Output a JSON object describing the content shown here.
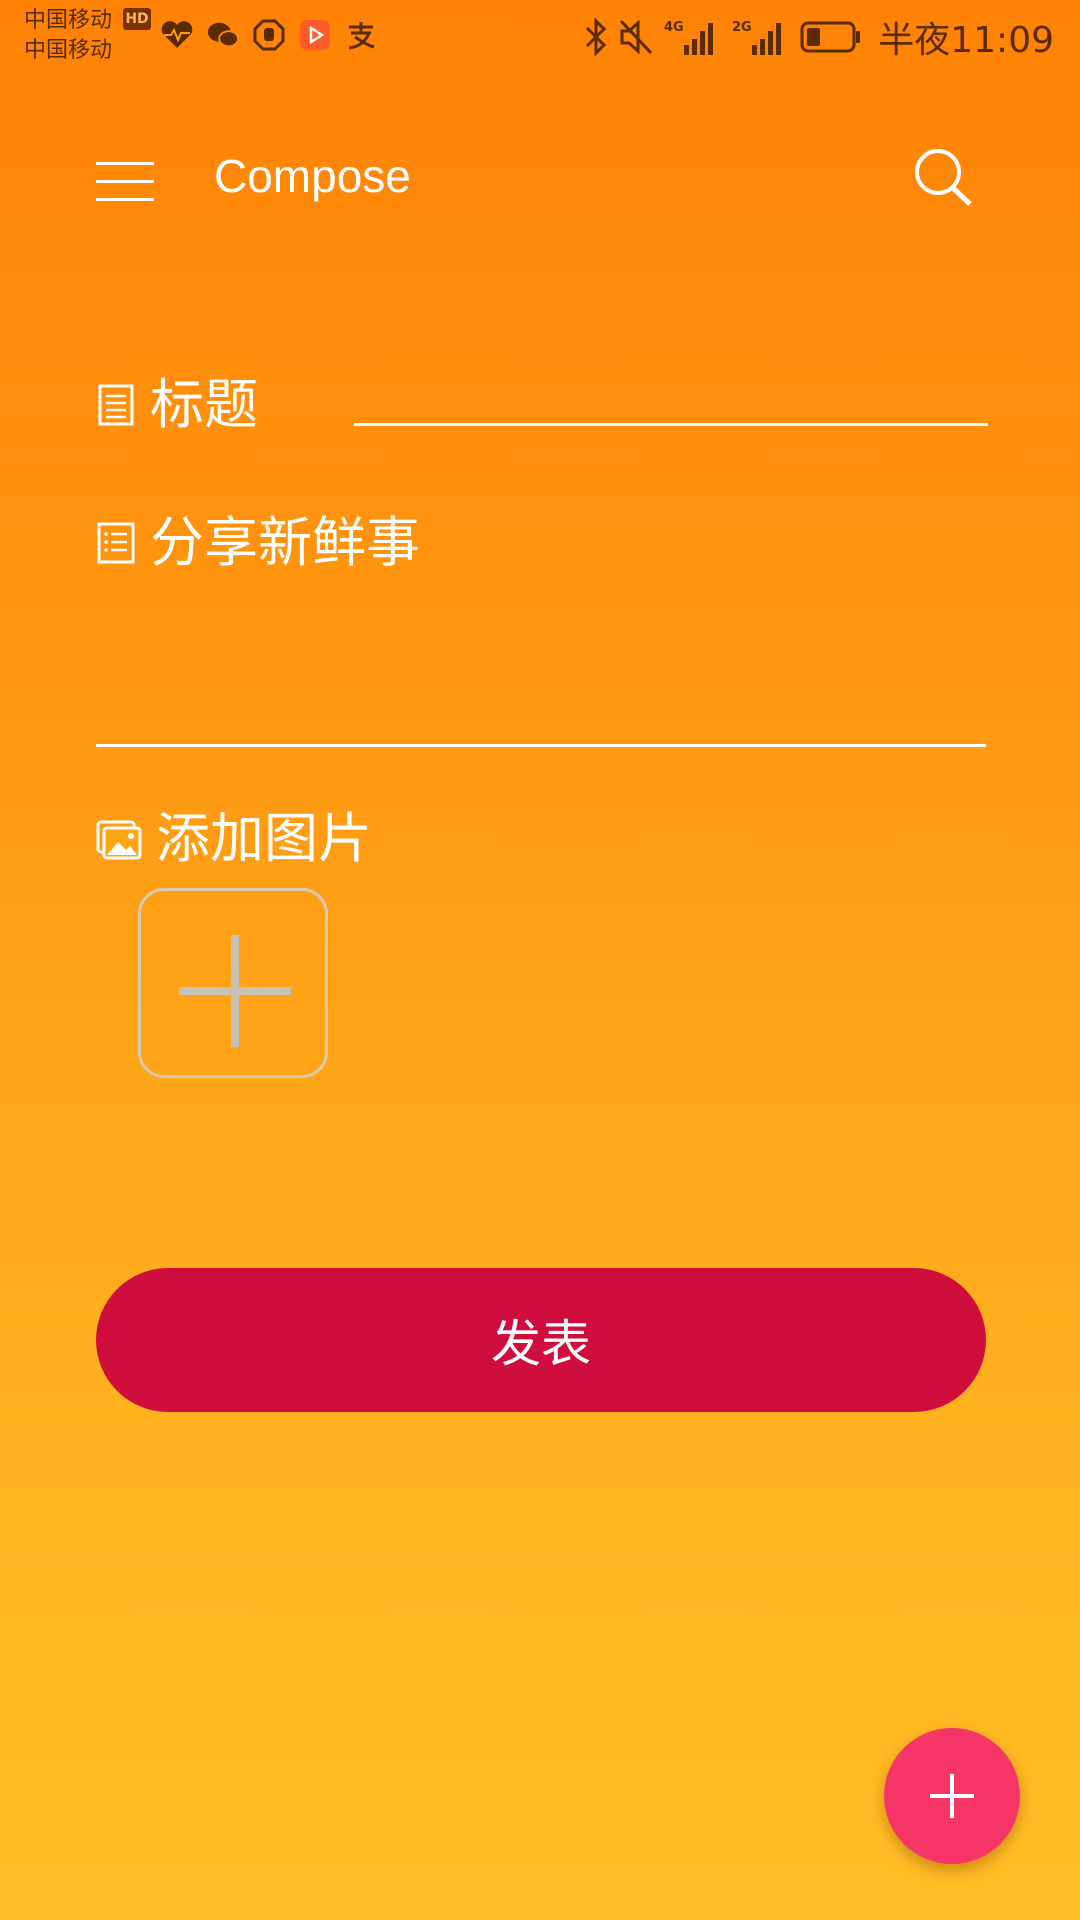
{
  "status_bar": {
    "carrier_1": "中国移动",
    "carrier_2": "中国移动",
    "hd_badge": "HD",
    "app_icons": [
      "health-heart-icon",
      "wechat-icon",
      "hand-stop-icon",
      "video-play-icon",
      "alipay-icon"
    ],
    "network_1": "4G",
    "network_2": "2G",
    "time": "半夜11:09",
    "battery_level": 0.3
  },
  "appbar": {
    "title": "Compose",
    "menu_icon": "hamburger-menu-icon",
    "search_icon": "search-icon"
  },
  "form": {
    "title_label": "标题",
    "title_value": "",
    "content_label": "分享新鲜事",
    "content_value": "",
    "image_label": "添加图片"
  },
  "actions": {
    "publish_label": "发表"
  },
  "colors": {
    "gradient_top": "#ff8205",
    "gradient_bottom": "#ffbf26",
    "publish_button": "#d00e3d",
    "fab": "#f43566",
    "status_text": "#5a2a00"
  }
}
